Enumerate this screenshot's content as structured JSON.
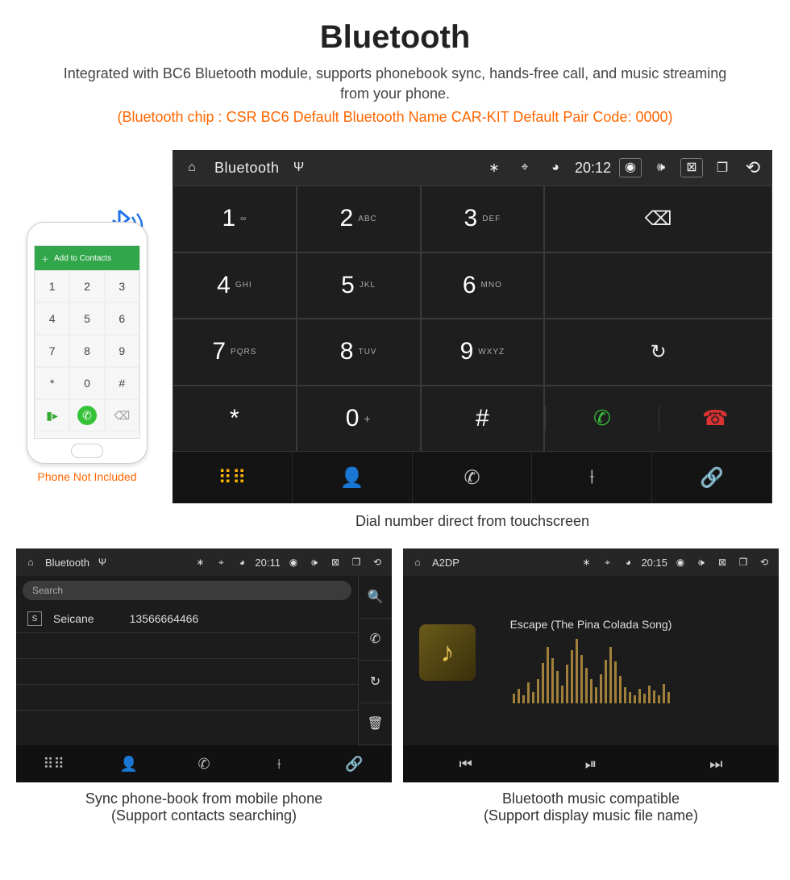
{
  "header": {
    "title": "Bluetooth",
    "desc": "Integrated with BC6 Bluetooth module, supports phonebook sync, hands-free call, and music streaming from your phone.",
    "specs": "(Bluetooth chip : CSR BC6    Default Bluetooth Name CAR-KIT    Default Pair Code: 0000)"
  },
  "phone": {
    "header_label": "Add to Contacts",
    "keys": [
      "1",
      "2",
      "3",
      "4",
      "5",
      "6",
      "7",
      "8",
      "9",
      "*",
      "0",
      "#"
    ],
    "note": "Phone Not Included"
  },
  "unit_big": {
    "status": {
      "title": "Bluetooth",
      "time": "20:12"
    },
    "keys": [
      {
        "n": "1",
        "l": "∞"
      },
      {
        "n": "2",
        "l": "ABC"
      },
      {
        "n": "3",
        "l": "DEF"
      },
      {
        "n": "4",
        "l": "GHI"
      },
      {
        "n": "5",
        "l": "JKL"
      },
      {
        "n": "6",
        "l": "MNO"
      },
      {
        "n": "7",
        "l": "PQRS"
      },
      {
        "n": "8",
        "l": "TUV"
      },
      {
        "n": "9",
        "l": "WXYZ"
      },
      {
        "n": "*",
        "l": ""
      },
      {
        "n": "0",
        "l": "+"
      },
      {
        "n": "#",
        "l": ""
      }
    ],
    "caption": "Dial number direct from touchscreen"
  },
  "unit_contacts": {
    "status": {
      "title": "Bluetooth",
      "time": "20:11"
    },
    "search_placeholder": "Search",
    "contact": {
      "badge": "S",
      "name": "Seicane",
      "number": "13566664466"
    },
    "caption_l1": "Sync phone-book from mobile phone",
    "caption_l2": "(Support contacts searching)"
  },
  "unit_music": {
    "status": {
      "title": "A2DP",
      "time": "20:15"
    },
    "track": "Escape (The Pina Colada Song)",
    "caption_l1": "Bluetooth music compatible",
    "caption_l2": "(Support display music file name)"
  }
}
